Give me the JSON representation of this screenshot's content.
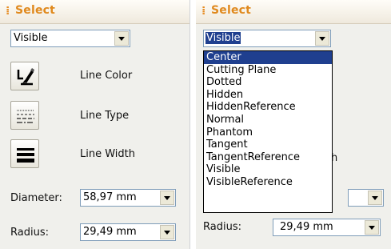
{
  "left_panel": {
    "title": "Select",
    "mode": "Visible",
    "tools": [
      {
        "label": "Line Color",
        "icon": "line-color-icon"
      },
      {
        "label": "Line Type",
        "icon": "line-type-icon"
      },
      {
        "label": "Line Width",
        "icon": "line-width-icon"
      }
    ],
    "diameter": {
      "label": "Diameter:",
      "value": "58,97 mm"
    },
    "radius": {
      "label": "Radius:",
      "value": "29,49 mm"
    }
  },
  "right_panel": {
    "title": "Select",
    "mode": "Visible",
    "options": [
      "Center",
      "Cutting Plane",
      "Dotted",
      "Hidden",
      "HiddenReference",
      "Normal",
      "Phantom",
      "Tangent",
      "TangentReference",
      "Visible",
      "VisibleReference"
    ],
    "highlighted_index": 0,
    "radius": {
      "label": "Radius:",
      "value": "29,49 mm"
    },
    "peek_label_h": "h"
  },
  "colors": {
    "header_text": "#e0891d",
    "selection": "#1f3f8f",
    "panel_bg": "#f0f0ec",
    "combo_border": "#7f9db9"
  }
}
